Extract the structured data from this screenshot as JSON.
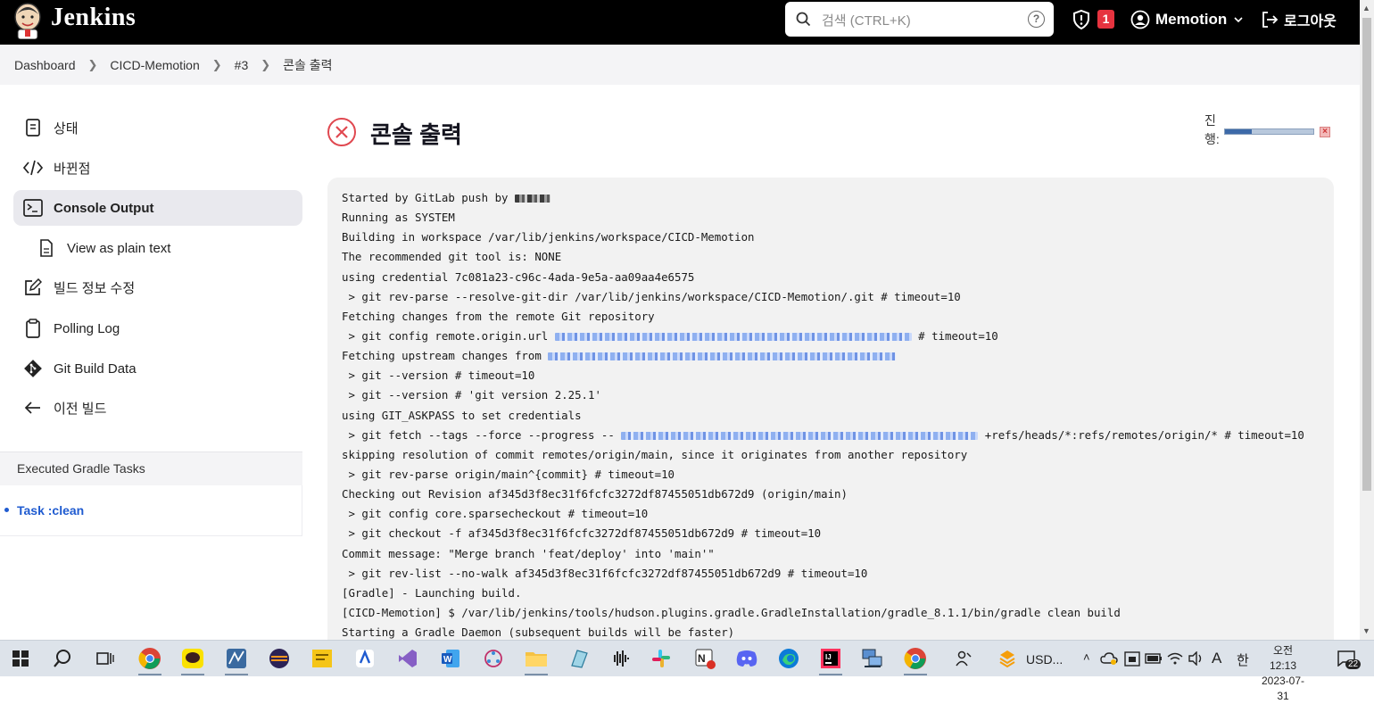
{
  "header": {
    "brand": "Jenkins",
    "search_placeholder": "검색 (CTRL+K)",
    "security_count": "1",
    "user_name": "Memotion",
    "logout_label": "로그아웃"
  },
  "breadcrumbs": [
    "Dashboard",
    "CICD-Memotion",
    "#3",
    "콘솔 출력"
  ],
  "sidebar": {
    "items": [
      {
        "label": "상태",
        "icon": "document-icon"
      },
      {
        "label": "바뀐점",
        "icon": "code-icon"
      },
      {
        "label": "Console Output",
        "icon": "terminal-icon"
      },
      {
        "label": "View as plain text",
        "icon": "file-icon"
      },
      {
        "label": "빌드 정보 수정",
        "icon": "edit-icon"
      },
      {
        "label": "Polling Log",
        "icon": "clipboard-icon"
      },
      {
        "label": "Git Build Data",
        "icon": "git-icon"
      },
      {
        "label": "이전 빌드",
        "icon": "arrow-left-icon"
      }
    ],
    "gradle_header": "Executed Gradle Tasks",
    "gradle_tasks": [
      "Task :clean"
    ]
  },
  "main": {
    "title": "콘솔 출력",
    "progress_label": "진행:",
    "progress": 0.3,
    "console_lines": [
      "Started by GitLab push by ",
      "Running as SYSTEM",
      "Building in workspace /var/lib/jenkins/workspace/CICD-Memotion",
      "The recommended git tool is: NONE",
      "using credential 7c081a23-c96c-4ada-9e5a-aa09aa4e6575",
      " > git rev-parse --resolve-git-dir /var/lib/jenkins/workspace/CICD-Memotion/.git # timeout=10",
      "Fetching changes from the remote Git repository",
      " > git config remote.origin.url ",
      "Fetching upstream changes from ",
      " > git --version # timeout=10",
      " > git --version # 'git version 2.25.1'",
      "using GIT_ASKPASS to set credentials",
      " > git fetch --tags --force --progress -- ",
      "skipping resolution of commit remotes/origin/main, since it originates from another repository",
      " > git rev-parse origin/main^{commit} # timeout=10",
      "Checking out Revision af345d3f8ec31f6fcfc3272df87455051db672d9 (origin/main)",
      " > git config core.sparsecheckout # timeout=10",
      " > git checkout -f af345d3f8ec31f6fcfc3272df87455051db672d9 # timeout=10",
      "Commit message: \"Merge branch 'feat/deploy' into 'main'\"",
      " > git rev-list --no-walk af345d3f8ec31f6fcfc3272df87455051db672d9 # timeout=10",
      "[Gradle] - Launching build.",
      "[CICD-Memotion] $ /var/lib/jenkins/tools/hudson.plugins.gradle.GradleInstallation/gradle_8.1.1/bin/gradle clean build",
      "Starting a Gradle Daemon (subsequent builds will be faster)"
    ],
    "console_suffixes": {
      "remote_url": "# timeout=10",
      "fetch_refspec": "+refs/heads/*:refs/remotes/origin/* # timeout=10"
    }
  },
  "taskbar": {
    "tray_text": "USD...",
    "ime": "A",
    "lang": "한",
    "time": "오전 12:13",
    "date": "2023-07-31",
    "notification_count": "22",
    "colors": {
      "accent": "#3d6aa8",
      "link": "#1f5bd0",
      "danger": "#e6333f"
    }
  }
}
